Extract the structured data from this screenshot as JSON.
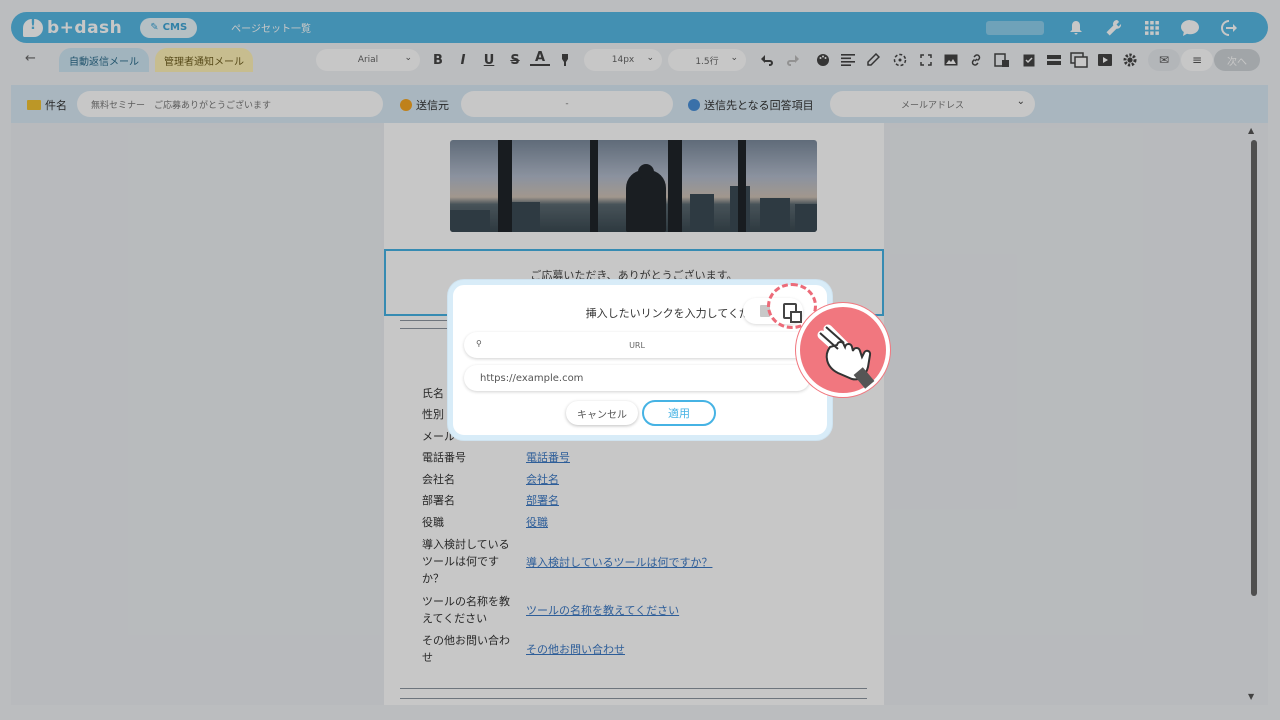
{
  "app": {
    "logo_text": "b+dash",
    "cms_label": "CMS",
    "page_title": "ページセット一覧"
  },
  "toolbar": {
    "back_glyph": "←",
    "tabs": [
      {
        "label": "自動返信メール"
      },
      {
        "label": "管理者通知メール"
      }
    ],
    "font_family_value": "Arial",
    "font_size_value": "14px",
    "line_height_value": "1.5行",
    "next_label": "次へ"
  },
  "header": {
    "subject_label": "件名",
    "subject_value": "無料セミナー　ご応募ありがとうございます",
    "sender_label": "送信元",
    "sender_value": "-",
    "recipient_label": "送信先となる回答項目",
    "recipient_value": "メールアドレス"
  },
  "email": {
    "thanks_text": "ご応募いただき、ありがとうございます。",
    "fields": [
      {
        "label": "氏名",
        "link": ""
      },
      {
        "label": "性別",
        "link": ""
      },
      {
        "label": "メール",
        "link": ""
      },
      {
        "label": "電話番号",
        "link": "電話番号"
      },
      {
        "label": "会社名",
        "link": "会社名"
      },
      {
        "label": "部署名",
        "link": "部署名"
      },
      {
        "label": "役職",
        "link": "役職"
      },
      {
        "label": "導入検討している\nツールは何です\nか？",
        "link": "導入検討しているツールは何ですか？"
      },
      {
        "label": "ツールの名称を教\nえてください",
        "link": "ツールの名称を教えてください"
      },
      {
        "label": "その他お問い合わ\nせ",
        "link": "その他お問い合わせ"
      }
    ]
  },
  "dialog": {
    "title": "挿入したいリンクを入力してください。",
    "search_placeholder": "URL",
    "url_placeholder": "https://example.com",
    "cancel_label": "キャンセル",
    "apply_label": "適用"
  },
  "colors": {
    "brand": "#57b9e4",
    "accent": "#46b3e4",
    "highlight": "#ec6b79",
    "link": "#3c79c4"
  }
}
